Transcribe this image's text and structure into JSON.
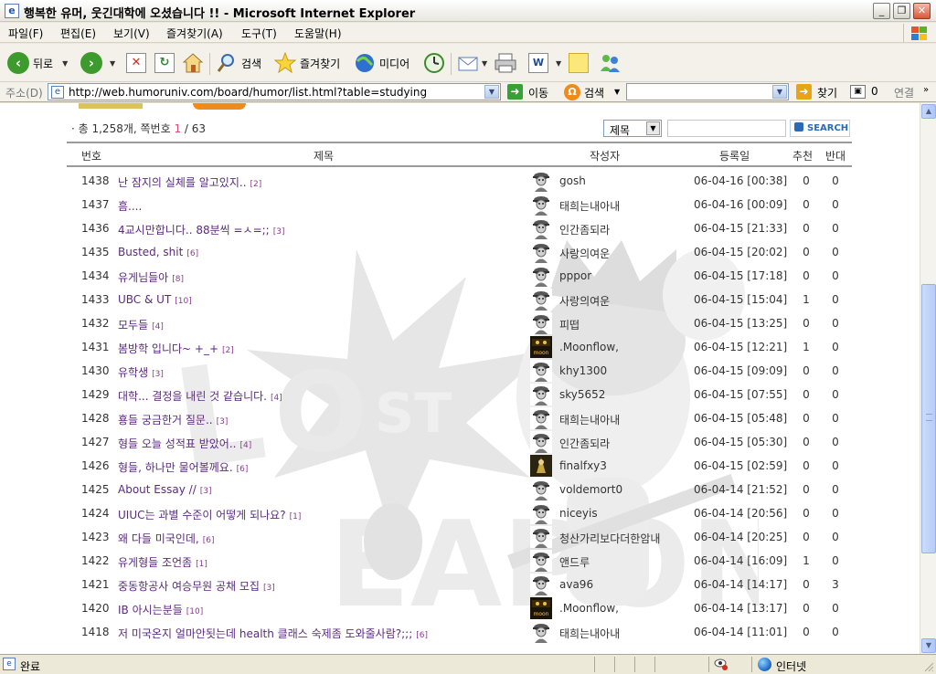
{
  "window": {
    "title": "행복한 유머, 웃긴대학에 오셨습니다 !! - Microsoft Internet Explorer",
    "controls": {
      "minimize": "_",
      "restore": "❐",
      "close": "✕"
    }
  },
  "menubar": [
    "파일(F)",
    "편집(E)",
    "보기(V)",
    "즐겨찾기(A)",
    "도구(T)",
    "도움말(H)"
  ],
  "toolbar": {
    "back": "뒤로",
    "search": "검색",
    "favorites": "즐겨찾기",
    "media": "미디어"
  },
  "address": {
    "label": "주소(D)",
    "url": "http://web.humoruniv.com/board/humor/list.html?table=studying",
    "go": "이동",
    "search_label": "검색",
    "find": "찾기",
    "popup_count": "0",
    "links": "연결"
  },
  "board": {
    "summary_prefix": "· 총 1,258개, 쪽번호 ",
    "current_page": "1",
    "summary_suffix": " / 63",
    "search_field": "제목",
    "search_button": "SEARCH",
    "headers": {
      "num": "번호",
      "title": "제목",
      "author": "작성자",
      "date": "등록일",
      "up": "추천",
      "down": "반대"
    },
    "rows": [
      {
        "num": "1438",
        "title": "난 잠지의 실체를 알고있지..",
        "comments": "[2]",
        "author": "gosh",
        "date": "06-04-16 [00:38]",
        "up": "0",
        "down": "0",
        "avatar": "soldier"
      },
      {
        "num": "1437",
        "title": "흠....",
        "comments": "",
        "author": "태희는내아내",
        "date": "06-04-16 [00:09]",
        "up": "0",
        "down": "0",
        "avatar": "soldier"
      },
      {
        "num": "1436",
        "title": "4교시만합니다.. 88분씩 =ㅅ=;;",
        "comments": "[3]",
        "author": "인간좀되라",
        "date": "06-04-15 [21:33]",
        "up": "0",
        "down": "0",
        "avatar": "soldier"
      },
      {
        "num": "1435",
        "title": "Busted, shit",
        "comments": "[6]",
        "author": "사랑의여운",
        "date": "06-04-15 [20:02]",
        "up": "0",
        "down": "0",
        "avatar": "soldier"
      },
      {
        "num": "1434",
        "title": "유게님들아",
        "comments": "[8]",
        "author": "pppor",
        "date": "06-04-15 [17:18]",
        "up": "0",
        "down": "0",
        "avatar": "soldier"
      },
      {
        "num": "1433",
        "title": "UBC & UT",
        "comments": "[10]",
        "author": "사랑의여운",
        "date": "06-04-15 [15:04]",
        "up": "1",
        "down": "0",
        "avatar": "soldier"
      },
      {
        "num": "1432",
        "title": "모두들",
        "comments": "[4]",
        "author": "피떱",
        "date": "06-04-15 [13:25]",
        "up": "0",
        "down": "0",
        "avatar": "soldier"
      },
      {
        "num": "1431",
        "title": "봄방학 입니다~ +_+",
        "comments": "[2]",
        "author": ".Moonflow,",
        "date": "06-04-15 [12:21]",
        "up": "1",
        "down": "0",
        "avatar": "moonflow"
      },
      {
        "num": "1430",
        "title": "유학생",
        "comments": "[3]",
        "author": "khy1300",
        "date": "06-04-15 [09:09]",
        "up": "0",
        "down": "0",
        "avatar": "soldier"
      },
      {
        "num": "1429",
        "title": "대학... 결정을 내린 것 같습니다.",
        "comments": "[4]",
        "author": "sky5652",
        "date": "06-04-15 [07:55]",
        "up": "0",
        "down": "0",
        "avatar": "soldier"
      },
      {
        "num": "1428",
        "title": "횽들 궁금한거 질문..",
        "comments": "[3]",
        "author": "태희는내아내",
        "date": "06-04-15 [05:48]",
        "up": "0",
        "down": "0",
        "avatar": "soldier"
      },
      {
        "num": "1427",
        "title": "형들 오늘 성적표 받았어..",
        "comments": "[4]",
        "author": "인간좀되라",
        "date": "06-04-15 [05:30]",
        "up": "0",
        "down": "0",
        "avatar": "soldier"
      },
      {
        "num": "1426",
        "title": "형들, 하나만 물어볼께요.",
        "comments": "[6]",
        "author": "finalfxy3",
        "date": "06-04-15 [02:59]",
        "up": "0",
        "down": "0",
        "avatar": "dark"
      },
      {
        "num": "1425",
        "title": "About Essay //",
        "comments": "[3]",
        "author": "voldemort0",
        "date": "06-04-14 [21:52]",
        "up": "0",
        "down": "0",
        "avatar": "soldier"
      },
      {
        "num": "1424",
        "title": "UIUC는 과별 수준이 어떻게 되나요?",
        "comments": "[1]",
        "author": "niceyis",
        "date": "06-04-14 [20:56]",
        "up": "0",
        "down": "0",
        "avatar": "soldier"
      },
      {
        "num": "1423",
        "title": "왜 다들 미국인데,",
        "comments": "[6]",
        "author": "청산가리보다더한암내",
        "date": "06-04-14 [20:25]",
        "up": "0",
        "down": "0",
        "avatar": "soldier"
      },
      {
        "num": "1422",
        "title": "유게형들 조언좀",
        "comments": "[1]",
        "author": "앤드루",
        "date": "06-04-14 [16:09]",
        "up": "1",
        "down": "0",
        "avatar": "soldier"
      },
      {
        "num": "1421",
        "title": "중동항공사 여승무원 공채 모집",
        "comments": "[3]",
        "author": "ava96",
        "date": "06-04-14 [14:17]",
        "up": "0",
        "down": "3",
        "avatar": "soldier"
      },
      {
        "num": "1420",
        "title": "IB 아시는분들",
        "comments": "[10]",
        "author": ".Moonflow,",
        "date": "06-04-14 [13:17]",
        "up": "0",
        "down": "0",
        "avatar": "moonflow"
      },
      {
        "num": "1418",
        "title": "저 미국온지 얼마안됫는데 health 클래스 숙제좀 도와줄사람?;;;",
        "comments": "[6]",
        "author": "태희는내아내",
        "date": "06-04-14 [11:01]",
        "up": "0",
        "down": "0",
        "avatar": "soldier"
      }
    ]
  },
  "status": {
    "text": "완료",
    "zone": "인터넷"
  }
}
